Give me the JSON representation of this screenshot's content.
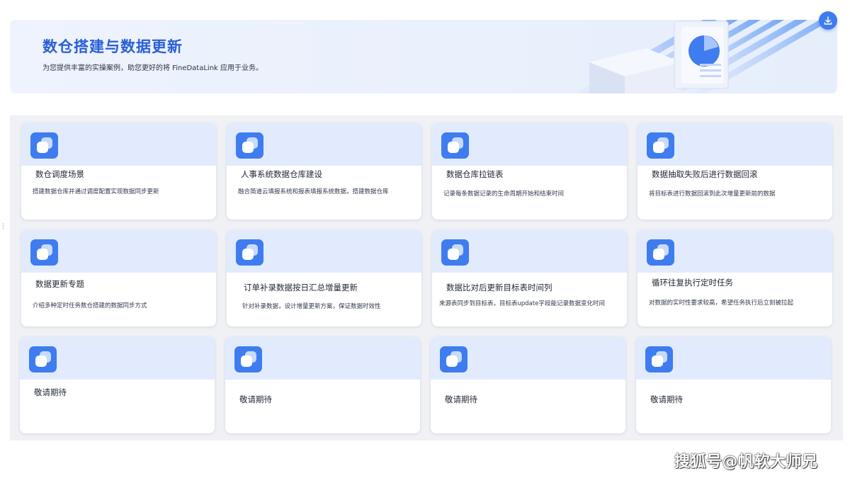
{
  "banner": {
    "title": "数仓搭建与数据更新",
    "subtitle": "为您提供丰富的实操案例，助您更好的将 FineDataLink 应用于业务。"
  },
  "toolbar": {
    "download_icon": "download-icon"
  },
  "cards": [
    {
      "title": "数仓调度场景",
      "desc": "搭建数据仓库并通过调度配置实现数据同步更新"
    },
    {
      "title": "人事系统数据仓库建设",
      "desc": "融合简道云填报系统和报表填报系统数据，搭建数据仓库"
    },
    {
      "title": "数据仓库拉链表",
      "desc": "记录每条数据记录的生命周期开始和结束时间"
    },
    {
      "title": "数据抽取失败后进行数据回滚",
      "desc": "将目标表进行数据回滚到此次增量更新前的数据"
    },
    {
      "title": "数据更新专题",
      "desc": "介绍多种定时任务数仓搭建的数据同步方式"
    },
    {
      "title": "订单补录数据按日汇总增量更新",
      "desc": "针对补录数据，设计增量更新方案，保证数据时效性"
    },
    {
      "title": "数据比对后更新目标表时间列",
      "desc": "来源表同步到目标表，目标表update字段能记录数据变化时间"
    },
    {
      "title": "循环往复执行定时任务",
      "desc": "对数据的实时性要求较高，希望任务执行后立刻被拉起"
    },
    {
      "title": "敬请期待",
      "desc": ""
    },
    {
      "title": "敬请期待",
      "desc": ""
    },
    {
      "title": "敬请期待",
      "desc": ""
    },
    {
      "title": "敬请期待",
      "desc": ""
    }
  ],
  "watermark": "搜狐号@帆软大师兄",
  "colors": {
    "accent": "#3e7cf0",
    "title": "#2a5fd8",
    "card_head": "#e1ebfd"
  }
}
